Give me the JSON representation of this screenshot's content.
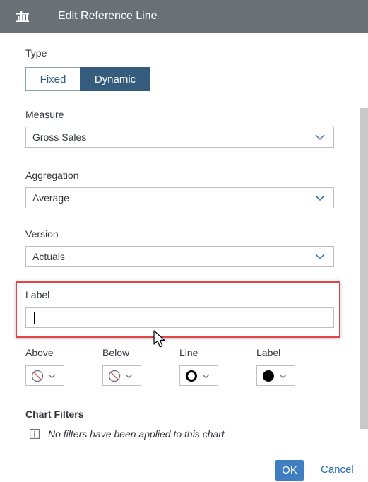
{
  "header": {
    "title": "Edit Reference Line",
    "icon": "reference-line-chart-icon"
  },
  "type": {
    "label": "Type",
    "options": [
      "Fixed",
      "Dynamic"
    ],
    "selected": "Dynamic"
  },
  "measure": {
    "label": "Measure",
    "value": "Gross Sales"
  },
  "aggregation": {
    "label": "Aggregation",
    "value": "Average"
  },
  "version": {
    "label": "Version",
    "value": "Actuals"
  },
  "label_field": {
    "label": "Label",
    "value": ""
  },
  "styles": {
    "above": {
      "label": "Above",
      "icon": "no-fill-icon"
    },
    "below": {
      "label": "Below",
      "icon": "no-fill-icon"
    },
    "line": {
      "label": "Line",
      "icon": "ring-icon"
    },
    "label": {
      "label": "Label",
      "icon": "filled-circle-icon"
    }
  },
  "chart_filters": {
    "title": "Chart Filters",
    "message": "No filters have been applied to this chart",
    "icon": "info-icon"
  },
  "footer": {
    "ok": "OK",
    "cancel": "Cancel"
  },
  "colors": {
    "header_bg": "#6a7176",
    "selected_segment": "#355b7d",
    "ok_button": "#3f7ec0",
    "highlight": "#e0454b"
  }
}
